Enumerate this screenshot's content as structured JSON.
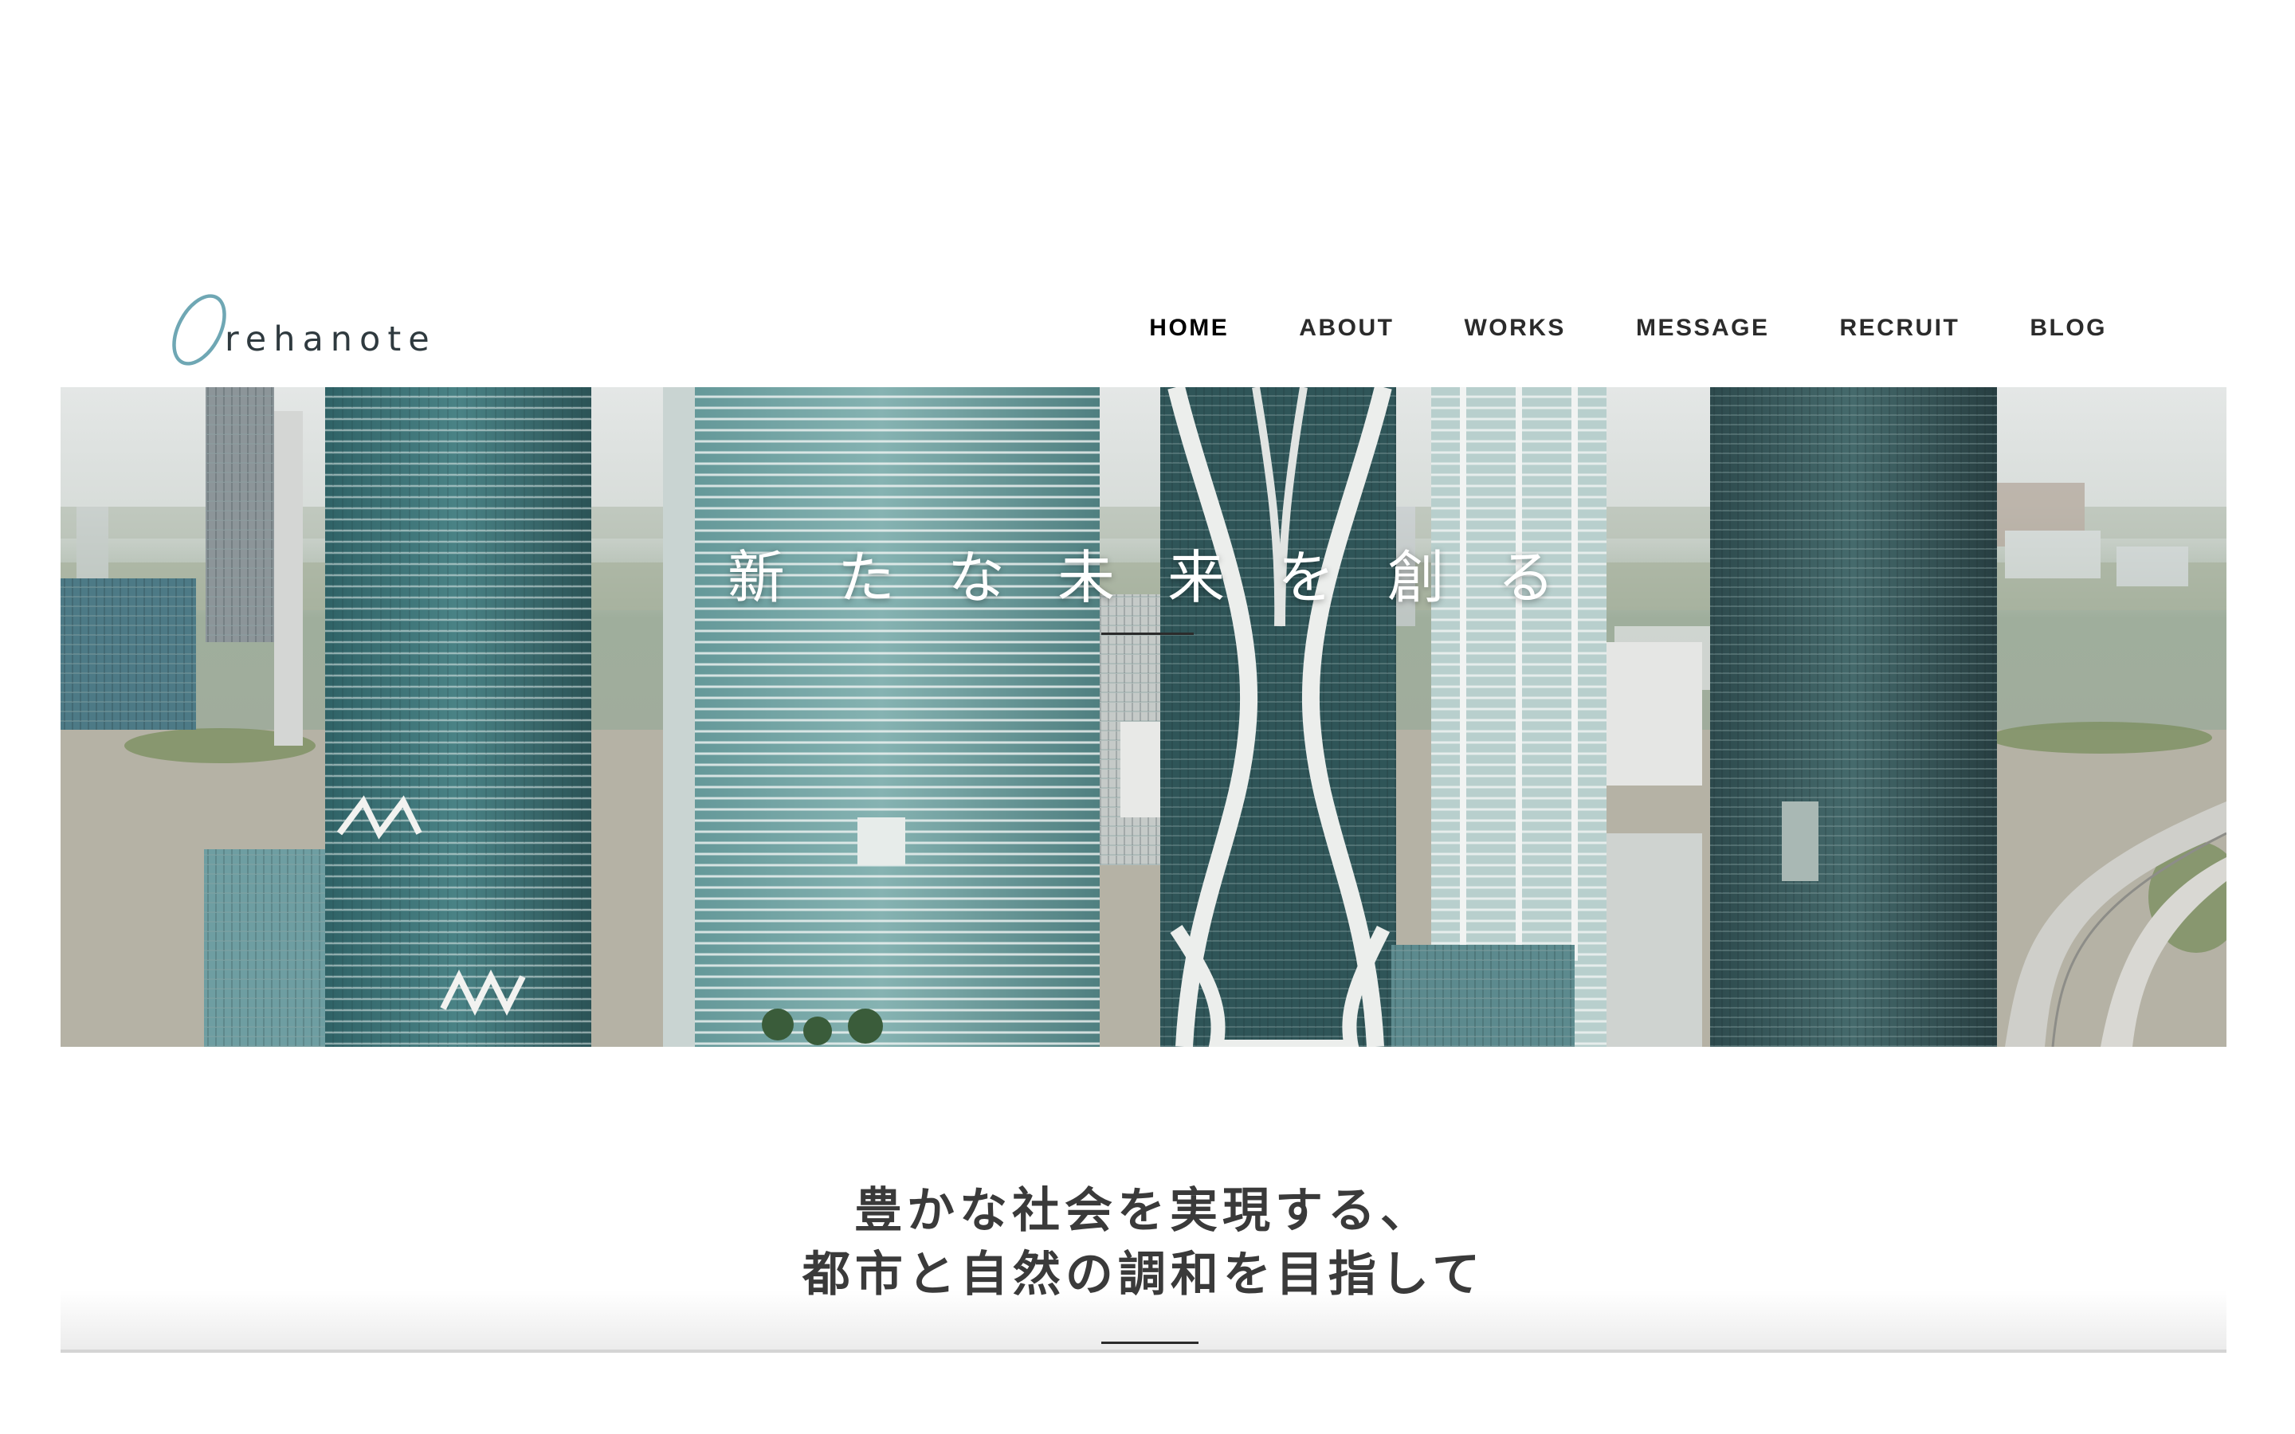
{
  "brand": {
    "logo_text": "rehanote",
    "logo_accent_color": "#6fa7b4"
  },
  "nav": {
    "items": [
      {
        "label": "HOME",
        "active": true
      },
      {
        "label": "ABOUT",
        "active": false
      },
      {
        "label": "WORKS",
        "active": false
      },
      {
        "label": "MESSAGE",
        "active": false
      },
      {
        "label": "RECRUIT",
        "active": false
      },
      {
        "label": "BLOG",
        "active": false
      }
    ]
  },
  "hero": {
    "headline": "新たな未来を創る",
    "image_icon": "city-skyline-photo"
  },
  "tagline": {
    "line1": "豊かな社会を実現する、",
    "line2": "都市と自然の調和を目指して"
  }
}
